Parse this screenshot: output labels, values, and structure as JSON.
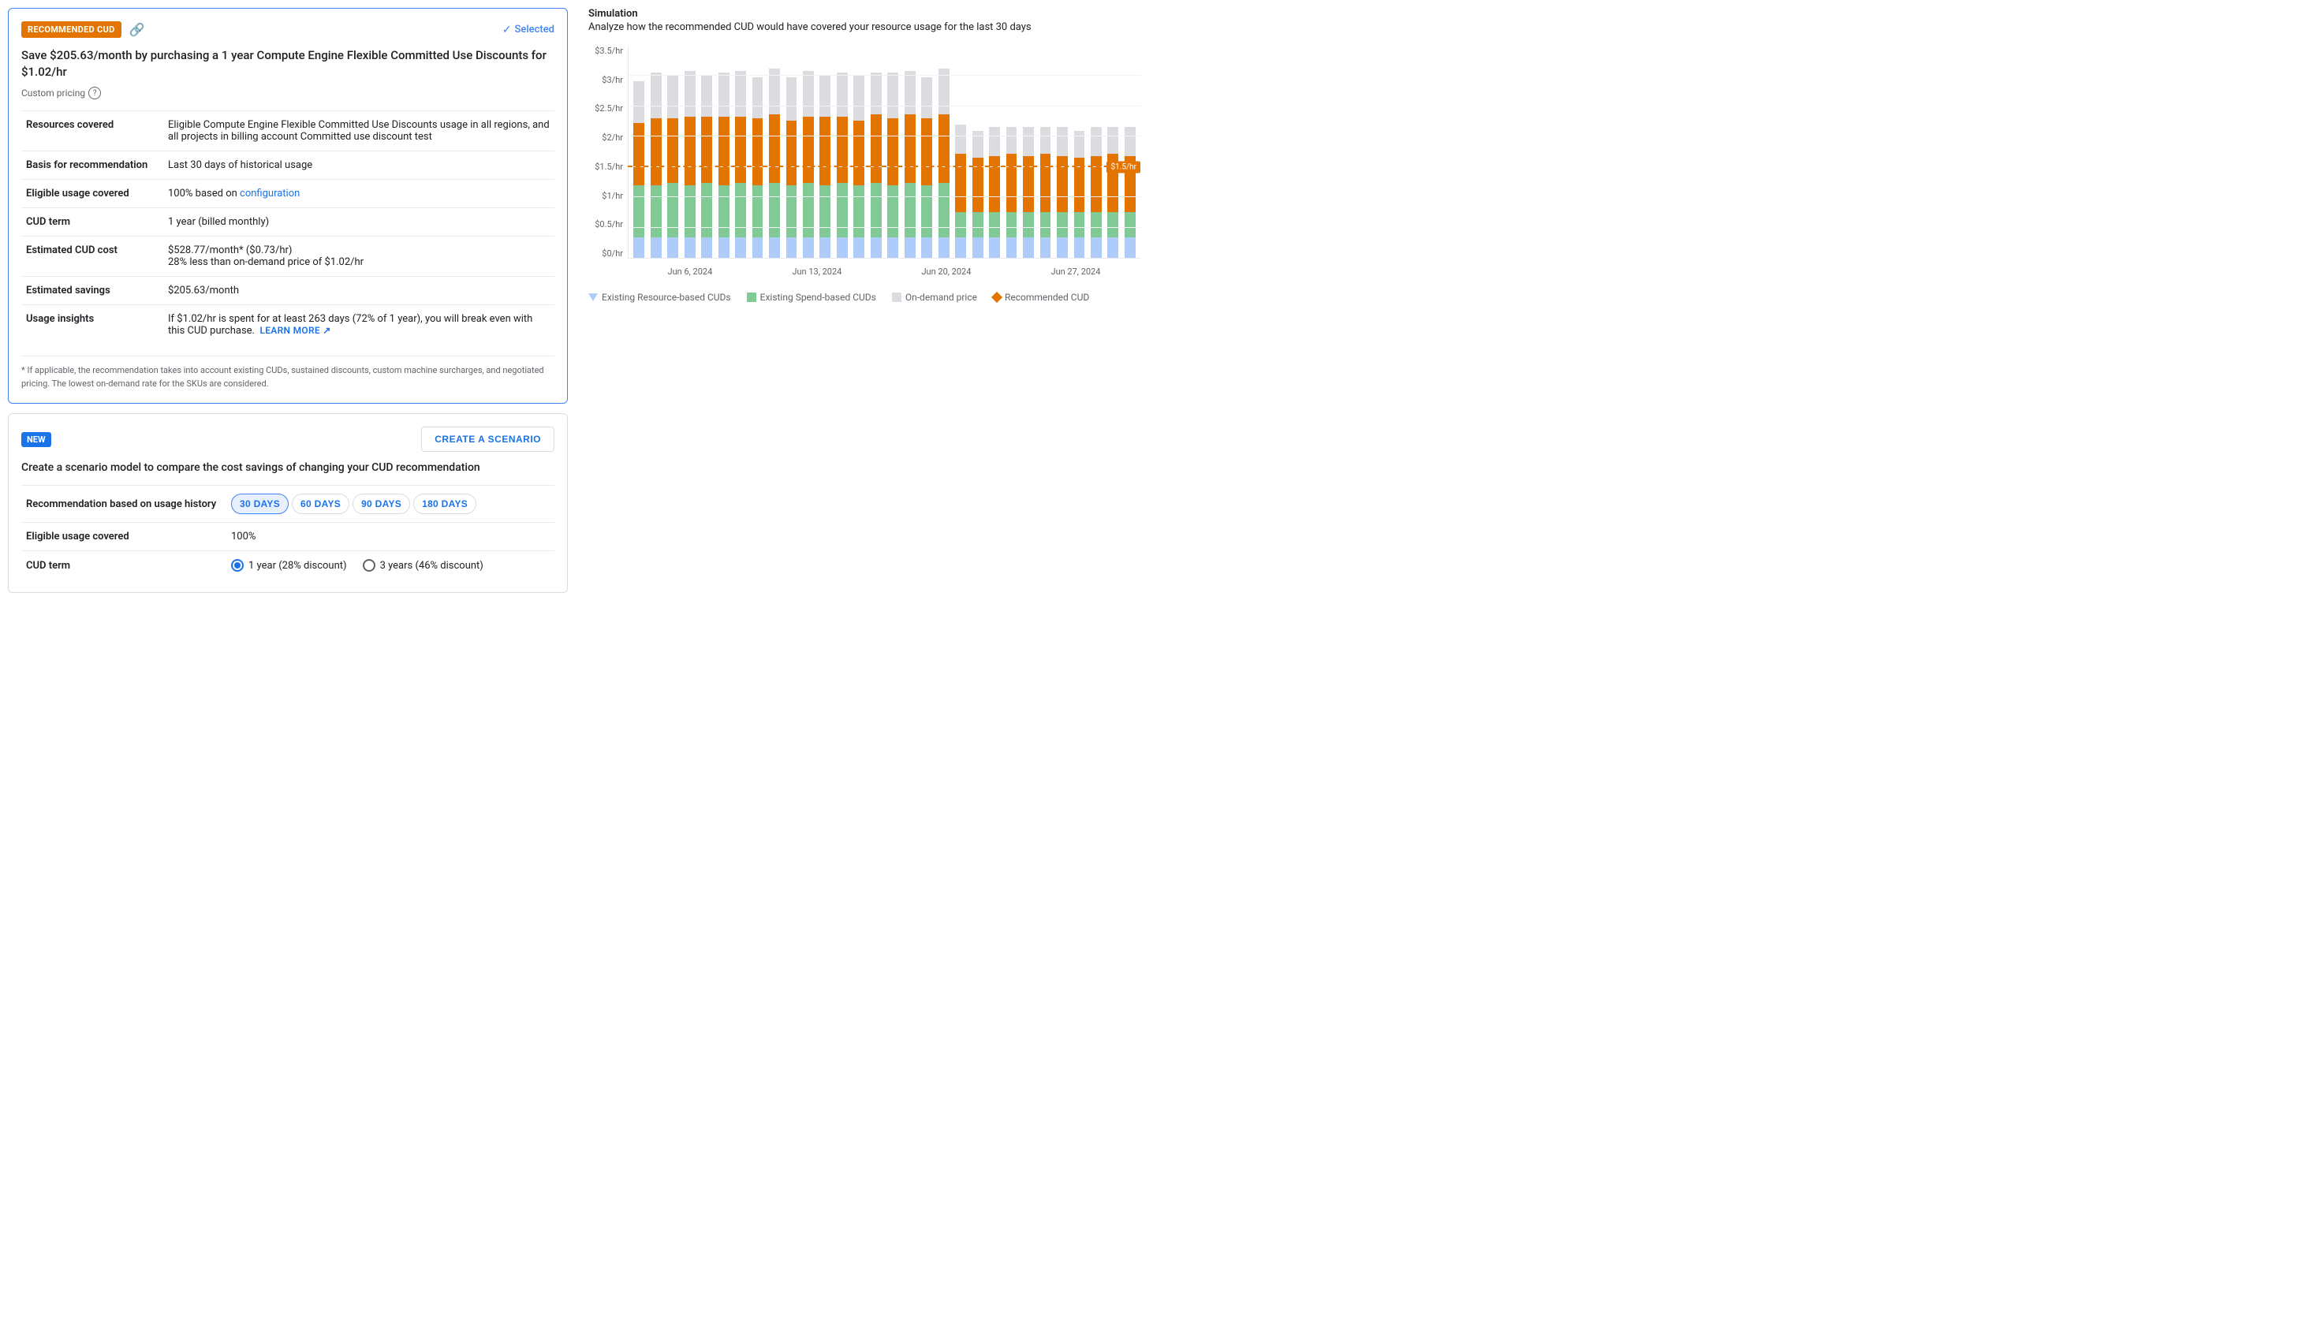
{
  "recommendedCard": {
    "badge": "RECOMMENDED CUD",
    "selectedLabel": "Selected",
    "title": "Save $205.63/month by purchasing a 1 year Compute Engine Flexible Committed Use Discounts for $1.02/hr",
    "customPricing": "Custom pricing",
    "rows": [
      {
        "label": "Resources covered",
        "value": "Eligible Compute Engine Flexible Committed Use Discounts usage in all regions, and all projects in billing account Committed use discount test",
        "hasLink": false
      },
      {
        "label": "Basis for recommendation",
        "value": "Last 30 days of historical usage",
        "hasLink": false
      },
      {
        "label": "Eligible usage covered",
        "value": "100% based on ",
        "linkText": "configuration",
        "hasLink": true
      },
      {
        "label": "CUD term",
        "value": "1 year (billed monthly)",
        "hasLink": false
      },
      {
        "label": "Estimated CUD cost",
        "value": "$528.77/month* ($0.73/hr)\n28% less than on-demand price of $1.02/hr",
        "hasLink": false
      },
      {
        "label": "Estimated savings",
        "value": "$205.63/month",
        "hasLink": false
      },
      {
        "label": "Usage insights",
        "value": "If $1.02/hr is spent for at least 263 days (72% of 1 year), you will break even with this CUD purchase.",
        "learnMore": "LEARN MORE",
        "hasLink": false
      }
    ],
    "footnote": "* If applicable, the recommendation takes into account existing CUDs, sustained discounts, custom machine surcharges, and negotiated pricing. The lowest on-demand rate for the SKUs are considered."
  },
  "scenarioCard": {
    "badge": "NEW",
    "createBtn": "CREATE A SCENARIO",
    "title": "Create a scenario model to compare the cost savings of changing your CUD recommendation",
    "rows": [
      {
        "label": "Recommendation based on usage history",
        "type": "chips",
        "chips": [
          "30 DAYS",
          "60 DAYS",
          "90 DAYS",
          "180 DAYS"
        ],
        "activeChip": 0
      },
      {
        "label": "Eligible usage covered",
        "type": "text",
        "value": "100%"
      },
      {
        "label": "CUD term",
        "type": "radio",
        "options": [
          "1 year (28% discount)",
          "3 years (46% discount)"
        ],
        "selected": 0
      }
    ]
  },
  "simulation": {
    "title": "Simulation",
    "subtitle": "Analyze how the recommended CUD would have covered your resource usage for the last 30 days",
    "yLabels": [
      "$3.5/hr",
      "$3/hr",
      "$2.5/hr",
      "$2/hr",
      "$1.5/hr",
      "$1/hr",
      "$0.5/hr",
      "$0/hr"
    ],
    "xLabels": [
      "Jun 6, 2024",
      "Jun 13, 2024",
      "Jun 20, 2024",
      "Jun 27, 2024"
    ],
    "dashedLineLabel": "$1.5/hr",
    "legend": [
      {
        "type": "triangle",
        "label": "Existing Resource-based CUDs"
      },
      {
        "type": "green",
        "label": "Existing Spend-based CUDs"
      },
      {
        "type": "gray",
        "label": "On-demand price"
      },
      {
        "type": "diamond",
        "label": "Recommended CUD"
      }
    ],
    "bars": [
      {
        "blue": 10,
        "green": 25,
        "orange": 30,
        "gray": 20
      },
      {
        "blue": 10,
        "green": 25,
        "orange": 32,
        "gray": 22
      },
      {
        "blue": 10,
        "green": 26,
        "orange": 31,
        "gray": 21
      },
      {
        "blue": 10,
        "green": 25,
        "orange": 33,
        "gray": 22
      },
      {
        "blue": 10,
        "green": 26,
        "orange": 32,
        "gray": 20
      },
      {
        "blue": 10,
        "green": 25,
        "orange": 33,
        "gray": 21
      },
      {
        "blue": 10,
        "green": 26,
        "orange": 32,
        "gray": 22
      },
      {
        "blue": 10,
        "green": 25,
        "orange": 32,
        "gray": 20
      },
      {
        "blue": 10,
        "green": 26,
        "orange": 33,
        "gray": 22
      },
      {
        "blue": 10,
        "green": 25,
        "orange": 31,
        "gray": 21
      },
      {
        "blue": 10,
        "green": 26,
        "orange": 32,
        "gray": 22
      },
      {
        "blue": 10,
        "green": 25,
        "orange": 33,
        "gray": 20
      },
      {
        "blue": 10,
        "green": 26,
        "orange": 32,
        "gray": 21
      },
      {
        "blue": 10,
        "green": 25,
        "orange": 31,
        "gray": 22
      },
      {
        "blue": 10,
        "green": 26,
        "orange": 33,
        "gray": 20
      },
      {
        "blue": 10,
        "green": 25,
        "orange": 32,
        "gray": 22
      },
      {
        "blue": 10,
        "green": 26,
        "orange": 33,
        "gray": 21
      },
      {
        "blue": 10,
        "green": 25,
        "orange": 32,
        "gray": 20
      },
      {
        "blue": 10,
        "green": 26,
        "orange": 33,
        "gray": 22
      },
      {
        "blue": 10,
        "green": 12,
        "orange": 28,
        "gray": 14
      },
      {
        "blue": 10,
        "green": 12,
        "orange": 26,
        "gray": 13
      },
      {
        "blue": 10,
        "green": 12,
        "orange": 27,
        "gray": 14
      },
      {
        "blue": 10,
        "green": 12,
        "orange": 28,
        "gray": 13
      },
      {
        "blue": 10,
        "green": 12,
        "orange": 27,
        "gray": 14
      },
      {
        "blue": 10,
        "green": 12,
        "orange": 28,
        "gray": 13
      },
      {
        "blue": 10,
        "green": 12,
        "orange": 27,
        "gray": 14
      },
      {
        "blue": 10,
        "green": 12,
        "orange": 26,
        "gray": 13
      },
      {
        "blue": 10,
        "green": 12,
        "orange": 27,
        "gray": 14
      },
      {
        "blue": 10,
        "green": 12,
        "orange": 28,
        "gray": 13
      },
      {
        "blue": 10,
        "green": 12,
        "orange": 27,
        "gray": 14
      }
    ]
  }
}
